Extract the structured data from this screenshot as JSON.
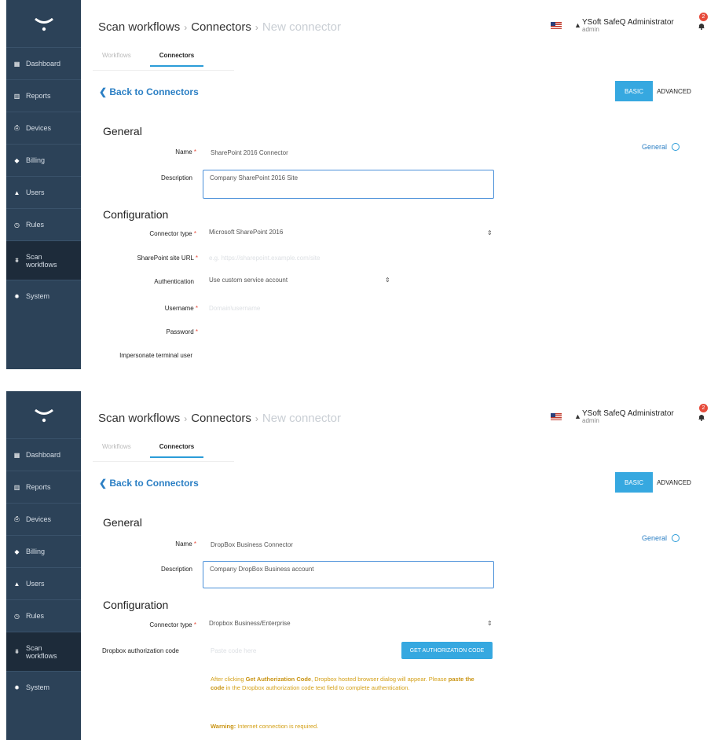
{
  "colors": {
    "sidebar": "#2c4258",
    "accent": "#2b9cd8",
    "link": "#2b7fc4",
    "required": "#e74c3c",
    "warning": "#d4a017"
  },
  "sidebar": {
    "items": [
      {
        "label": "Dashboard",
        "icon": "grid-icon"
      },
      {
        "label": "Reports",
        "icon": "bar-chart-icon"
      },
      {
        "label": "Devices",
        "icon": "printer-icon"
      },
      {
        "label": "Billing",
        "icon": "tag-icon"
      },
      {
        "label": "Users",
        "icon": "user-icon"
      },
      {
        "label": "Rules",
        "icon": "clock-icon"
      },
      {
        "label_line1": "Scan",
        "label_line2": "workflows",
        "icon": "scan-icon",
        "active": true
      },
      {
        "label": "System",
        "icon": "gear-icon"
      }
    ]
  },
  "header": {
    "breadcrumb": {
      "root": "Scan workflows",
      "sep": "›",
      "middle": "Connectors",
      "current": "New connector"
    },
    "user_name": "YSoft SafeQ Administrator",
    "user_role": "admin",
    "notification_count": "2"
  },
  "tabs": {
    "workflows": "Workflows",
    "connectors": "Connectors"
  },
  "back_link": "❮ Back to Connectors",
  "mode": {
    "basic": "BASIC",
    "advanced": "ADVANCED"
  },
  "sections": {
    "general": "General",
    "configuration": "Configuration"
  },
  "side_nav": {
    "general": "General"
  },
  "labels": {
    "name": "Name",
    "description": "Description",
    "connector_type": "Connector type",
    "sharepoint_url": "SharePoint site URL",
    "authentication": "Authentication",
    "username": "Username",
    "password": "Password",
    "impersonate": "Impersonate terminal user",
    "dropbox_code": "Dropbox authorization code",
    "required_mark": "*"
  },
  "form1": {
    "name": "SharePoint 2016 Connector",
    "description": "Company SharePoint 2016 Site",
    "connector_type": "Microsoft SharePoint 2016",
    "url_placeholder": "e.g. https://sharepoint.example.com/site",
    "authentication": "Use custom service account",
    "username_placeholder": "Domain\\username"
  },
  "form2": {
    "name": "DropBox Business Connector",
    "description": "Company DropBox Business account",
    "connector_type": "Dropbox Business/Enterprise",
    "code_placeholder": "Paste code here",
    "auth_button": "GET AUTHORIZATION CODE",
    "note_pre": "After clicking ",
    "note_bold1": "Get Authorization Code",
    "note_mid": ", Dropbox hosted browser dialog will appear. Please ",
    "note_bold2": "paste the code",
    "note_post": " in the Dropbox authorization code text field to complete authentication.",
    "warning_label": "Warning:",
    "warning_text": " Internet connection is required."
  }
}
